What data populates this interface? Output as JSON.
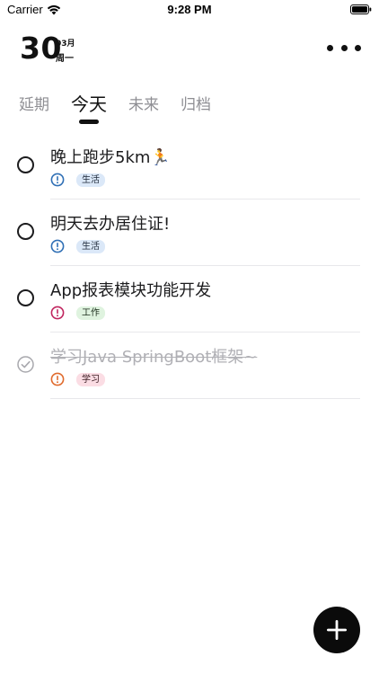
{
  "status_bar": {
    "carrier": "Carrier",
    "time": "9:28 PM"
  },
  "header": {
    "day": "30",
    "month": "03月",
    "weekday": "周一"
  },
  "tabs": [
    {
      "label": "延期",
      "active": false
    },
    {
      "label": "今天",
      "active": true
    },
    {
      "label": "未来",
      "active": false
    },
    {
      "label": "归档",
      "active": false
    }
  ],
  "tasks": [
    {
      "title": "晚上跑步5km🏃",
      "done": false,
      "priority": "blue",
      "tag": "生活",
      "tag_type": "life"
    },
    {
      "title": "明天去办居住证!",
      "done": false,
      "priority": "blue",
      "tag": "生活",
      "tag_type": "life"
    },
    {
      "title": "App报表模块功能开发",
      "done": false,
      "priority": "red",
      "tag": "工作",
      "tag_type": "work"
    },
    {
      "title": "学习Java SpringBoot框架~",
      "done": true,
      "priority": "orange",
      "tag": "学习",
      "tag_type": "study"
    }
  ],
  "colors": {
    "priority_blue": "#2f6fb5",
    "priority_red": "#c0245e",
    "priority_orange": "#e06a2c",
    "accent": "#0b0b0b"
  },
  "icons": {
    "more": "more-icon",
    "add": "plus-icon",
    "check": "checkmark-circle-icon"
  }
}
